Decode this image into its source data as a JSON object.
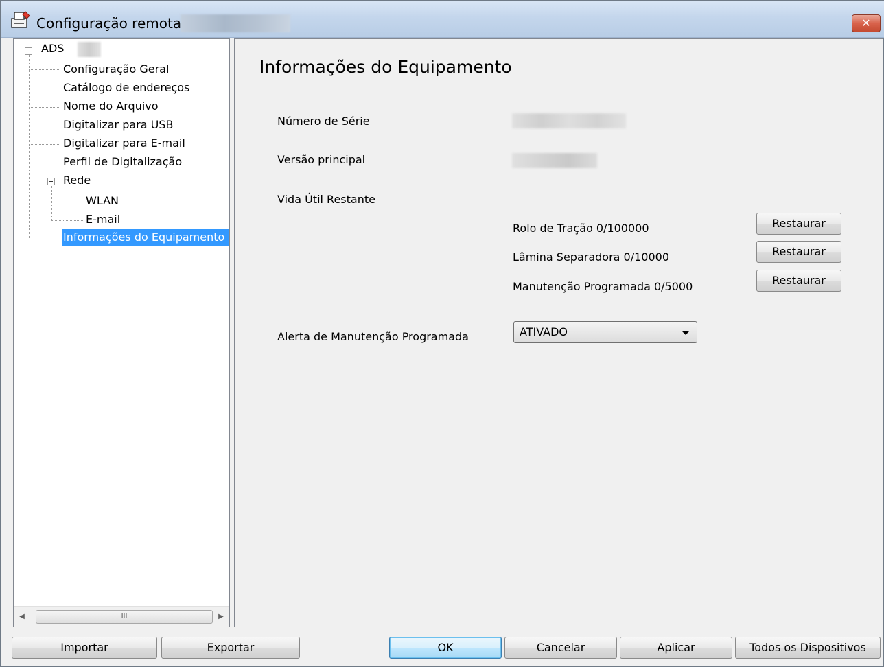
{
  "window": {
    "title": "Configuração remota -",
    "close_label": "✕"
  },
  "tree": {
    "root": "ADS",
    "items": [
      "Configuração Geral",
      "Catálogo de endereços",
      "Nome do Arquivo",
      "Digitalizar para USB",
      "Digitalizar para E-mail",
      "Perfil de Digitalização",
      "Rede",
      "WLAN",
      "E-mail",
      "Informações do Equipamento"
    ],
    "selected": "Informações do Equipamento",
    "scroll_thumb": "III"
  },
  "content": {
    "heading": "Informações do Equipamento",
    "serial_label": "Número de Série",
    "version_label": "Versão principal",
    "life_label": "Vida Útil Restante",
    "counters": [
      {
        "label": "Rolo de Tração 0/100000",
        "button": "Restaurar"
      },
      {
        "label": "Lâmina Separadora 0/10000",
        "button": "Restaurar"
      },
      {
        "label": "Manutenção Programada 0/5000",
        "button": "Restaurar"
      }
    ],
    "alert_label": "Alerta de Manutenção Programada",
    "alert_value": "ATIVADO"
  },
  "footer": {
    "import": "Importar",
    "export": "Exportar",
    "ok": "OK",
    "cancel": "Cancelar",
    "apply": "Aplicar",
    "all_devices": "Todos os Dispositivos"
  }
}
